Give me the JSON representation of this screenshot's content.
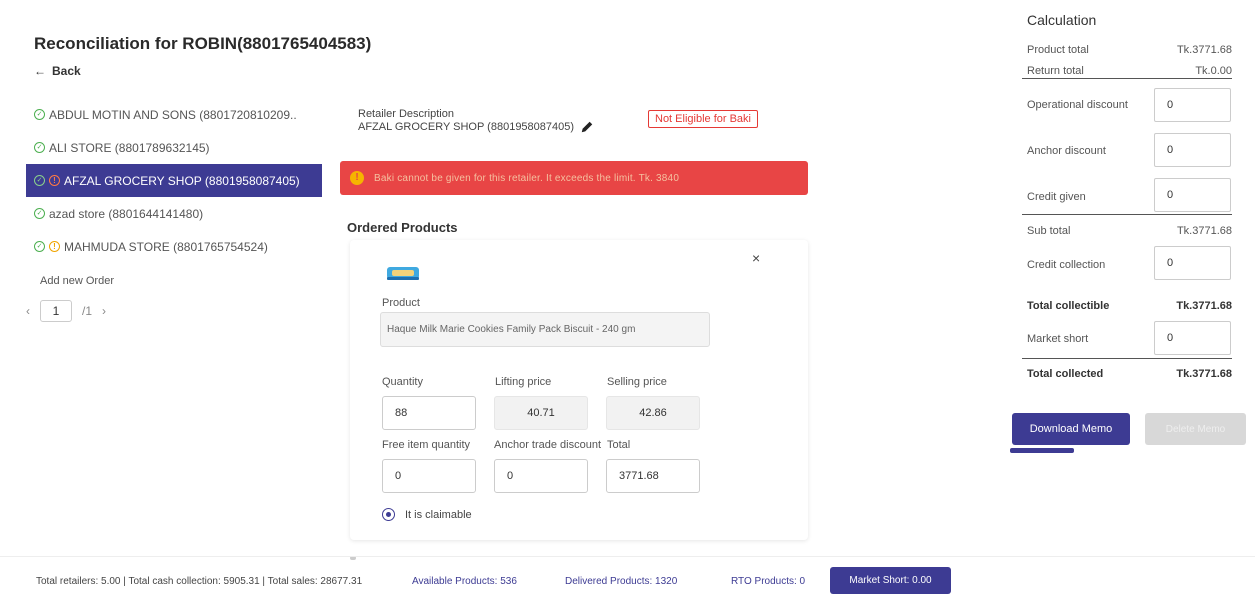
{
  "header": {
    "title": "Reconciliation for ROBIN(8801765404583)",
    "back_label": "Back"
  },
  "retailers": [
    {
      "name": "ABDUL MOTIN AND SONS (8801720810209..",
      "warn": false,
      "active": false
    },
    {
      "name": "ALI STORE (8801789632145)",
      "warn": false,
      "active": false
    },
    {
      "name": "AFZAL GROCERY SHOP (8801958087405)",
      "warn": true,
      "active": true
    },
    {
      "name": "azad store (8801644141480)",
      "warn": false,
      "active": false
    },
    {
      "name": "MAHMUDA STORE (8801765754524)",
      "warn": true,
      "active": false
    }
  ],
  "add_order_label": "Add new Order",
  "pager": {
    "current": "1",
    "total": "/1"
  },
  "detail": {
    "desc_label": "Retailer Description",
    "desc_value": "AFZAL GROCERY SHOP (8801958087405)",
    "badge": "Not Eligible for Baki",
    "alert_text": "Baki cannot be given for this retailer. It exceeds the limit. Tk. 3840",
    "ordered_title": "Ordered Products",
    "close_label": "×",
    "product_label": "Product",
    "product_value": "Haque Milk Marie Cookies Family Pack Biscuit - 240 gm",
    "quantity_label": "Quantity",
    "quantity_value": "88",
    "lifting_label": "Lifting price",
    "lifting_value": "40.71",
    "selling_label": "Selling price",
    "selling_value": "42.86",
    "free_label": "Free item quantity",
    "free_value": "0",
    "anchor_label": "Anchor trade discount",
    "anchor_value": "0",
    "total_label": "Total",
    "total_value": "3771.68",
    "claimable_label": "It is claimable"
  },
  "calc": {
    "title": "Calculation",
    "product_total_label": "Product total",
    "product_total": "Tk.3771.68",
    "return_total_label": "Return total",
    "return_total": "Tk.0.00",
    "op_discount_label": "Operational discount",
    "op_discount": "0",
    "anchor_discount_label": "Anchor discount",
    "anchor_discount": "0",
    "credit_given_label": "Credit given",
    "credit_given": "0",
    "subtotal_label": "Sub total",
    "subtotal": "Tk.3771.68",
    "credit_collection_label": "Credit collection",
    "credit_collection": "0",
    "total_collectible_label": "Total collectible",
    "total_collectible": "Tk.3771.68",
    "market_short_label": "Market short",
    "market_short": "0",
    "total_collected_label": "Total collected",
    "total_collected": "Tk.3771.68",
    "download_label": "Download Memo",
    "delete_label": "Delete Memo"
  },
  "footer": {
    "summary": "Total retailers: 5.00  | Total cash collection: 5905.31  | Total sales: 28677.31",
    "available": "Available Products: 536",
    "delivered": "Delivered Products: 1320",
    "rto": "RTO Products: 0",
    "market_short": "Market Short: 0.00"
  }
}
